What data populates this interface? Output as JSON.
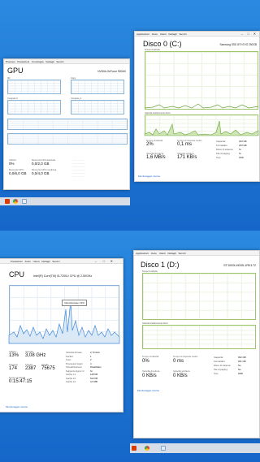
{
  "gpu": {
    "title": "GPU",
    "model": "NVIDIA GeForce 920MX",
    "graphs": [
      "3D",
      "Copy",
      "Compute 0",
      "Compute_1"
    ],
    "stat_labels": [
      "Utilizzo",
      "Memoria GPU dedicata",
      "Memoria GPU condivisa"
    ],
    "stat_values": [
      "0%",
      "0,0/2,0 GB",
      "0,0/4,0 GB"
    ],
    "extra_label": "Memoria GPU",
    "extra_value": "0,0/6,0 GB"
  },
  "disk0": {
    "title": "Disco 0 (C:)",
    "model": "Samsung SSD 870 EVO 250GB",
    "tabs": [
      "Applicazioni",
      "Avvio",
      "Utenti",
      "Dettagli",
      "Servizi"
    ],
    "graph1_label": "Tempo di attività",
    "graph2_label": "Velocità trasferimento disco",
    "stats": [
      {
        "label": "Tempo di attività",
        "value": "2%"
      },
      {
        "label": "Tempo di risposta medio",
        "value": "0,1 ms"
      },
      {
        "label": "Velocità di lettura",
        "value": "1,6 MB/s"
      },
      {
        "label": "Velocità scrittura",
        "value": "171 KB/s"
      }
    ],
    "props": [
      {
        "k": "Capacità:",
        "v": "233 GB"
      },
      {
        "k": "Formattato:",
        "v": "233 GB"
      },
      {
        "k": "Disco di sistema:",
        "v": "Sì"
      },
      {
        "k": "File di paging:",
        "v": "Sì"
      },
      {
        "k": "Tipo:",
        "v": "SSD"
      }
    ],
    "link": "Monitoraggio risorse"
  },
  "cpu": {
    "title": "CPU",
    "model": "Intel(R) Core(TM) i5-7200U CPU @ 2.50GHz",
    "tabs": [
      "Prestazioni",
      "Avvio",
      "Utenti",
      "Dettagli",
      "Servizi"
    ],
    "tooltip": "Velocità base CPU",
    "stats": [
      {
        "label": "Utilizzo",
        "value": "13%"
      },
      {
        "label": "Velocità",
        "value": "3,08 GHz"
      },
      {
        "label": "Processi",
        "value": "174"
      },
      {
        "label": "Thread",
        "value": "2387"
      },
      {
        "label": "Handle",
        "value": "75675"
      },
      {
        "label": "Tempo di attività",
        "value": "0:15:47:15"
      }
    ],
    "props": [
      {
        "k": "Velocità di base:",
        "v": "2,70 GHz"
      },
      {
        "k": "Socket:",
        "v": "1"
      },
      {
        "k": "Core:",
        "v": "2"
      },
      {
        "k": "Processori logici:",
        "v": "4"
      },
      {
        "k": "Virtualizzazione:",
        "v": "Disabilitato"
      },
      {
        "k": "Supporto Hyper-V:",
        "v": "Sì"
      },
      {
        "k": "Cache L1:",
        "v": "128 KB"
      },
      {
        "k": "Cache L2:",
        "v": "512 KB"
      },
      {
        "k": "Cache L3:",
        "v": "3,0 MB"
      }
    ],
    "link": "Monitoraggio risorse"
  },
  "disk1": {
    "title": "Disco 1 (D:)",
    "model": "ST1000LM035-1RK172",
    "tabs": [
      "Applicazioni",
      "Avvio",
      "Utenti",
      "Dettagli",
      "Servizi"
    ],
    "graph1_label": "Tempo di attività",
    "graph2_label": "Velocità trasferimento disco",
    "stats": [
      {
        "label": "Tempo di attività",
        "value": "0%"
      },
      {
        "label": "Tempo di risposta medio",
        "value": "0 ms"
      },
      {
        "label": "Velocità di lettura",
        "value": "0 KB/s"
      },
      {
        "label": "Velocità scrittura",
        "value": "0 KB/s"
      }
    ],
    "props": [
      {
        "k": "Capacità:",
        "v": "932 GB"
      },
      {
        "k": "Formattato:",
        "v": "931 GB"
      },
      {
        "k": "Disco di sistema:",
        "v": "No"
      },
      {
        "k": "File di paging:",
        "v": "No"
      },
      {
        "k": "Tipo:",
        "v": "HDD"
      }
    ],
    "link": "Monitoraggio risorse"
  }
}
